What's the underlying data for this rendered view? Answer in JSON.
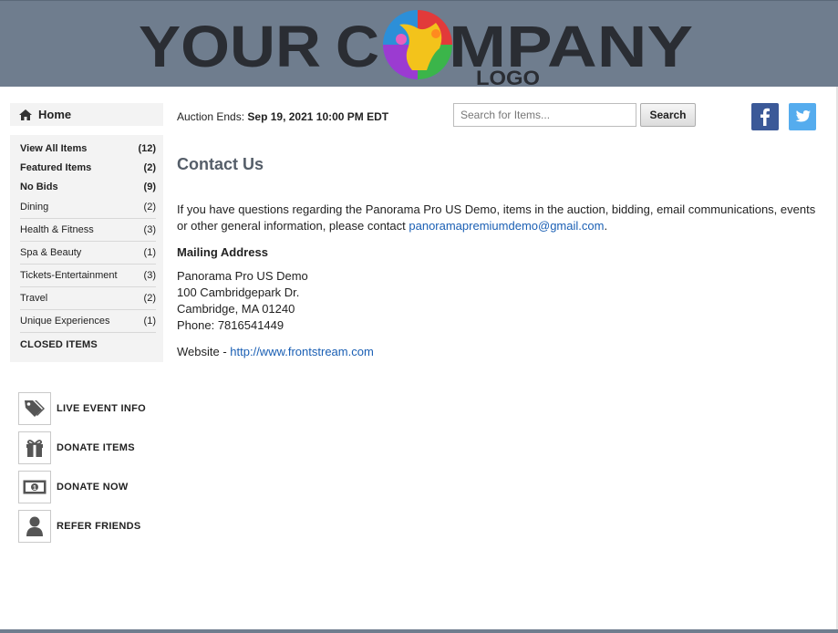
{
  "header": {
    "logo_text": "YOUR COMPANY LOGO"
  },
  "sidebar": {
    "home_label": "Home",
    "categories": [
      {
        "label": "View All Items",
        "count": "(12)"
      },
      {
        "label": "Featured Items",
        "count": "(2)"
      },
      {
        "label": "No Bids",
        "count": "(9)"
      },
      {
        "label": "Dining",
        "count": "(2)"
      },
      {
        "label": "Health & Fitness",
        "count": "(3)"
      },
      {
        "label": "Spa & Beauty",
        "count": "(1)"
      },
      {
        "label": "Tickets-Entertainment",
        "count": "(3)"
      },
      {
        "label": "Travel",
        "count": "(2)"
      },
      {
        "label": "Unique Experiences",
        "count": "(1)"
      }
    ],
    "closed_items": "CLOSED ITEMS",
    "actions": [
      {
        "label": "LIVE EVENT INFO",
        "icon": "tags-icon"
      },
      {
        "label": "DONATE ITEMS",
        "icon": "gift-icon"
      },
      {
        "label": "DONATE NOW",
        "icon": "money-icon"
      },
      {
        "label": "REFER FRIENDS",
        "icon": "user-icon"
      }
    ]
  },
  "topbar": {
    "auction_label": "Auction Ends:",
    "auction_date": "Sep 19, 2021 10:00 PM EDT",
    "search_placeholder": "Search for Items...",
    "search_button": "Search"
  },
  "content": {
    "title": "Contact Us",
    "para_text": "If you have questions regarding the Panorama Pro US Demo, items in the auction, bidding, email communications, events or other general information, please contact ",
    "email": "panoramapremiumdemo@gmail.com",
    "para_end": ".",
    "mailing_heading": "Mailing Address",
    "address_lines": [
      "Panorama Pro US Demo",
      "100 Cambridgepark Dr.",
      "Cambridge, MA 01240",
      "Phone: 7816541449"
    ],
    "website_label": "Website - ",
    "website_url": "http://www.frontstream.com"
  },
  "colors": {
    "header_bg": "#6f7d8e",
    "link": "#1a5fb4",
    "facebook": "#3b5998",
    "twitter": "#55acee"
  }
}
